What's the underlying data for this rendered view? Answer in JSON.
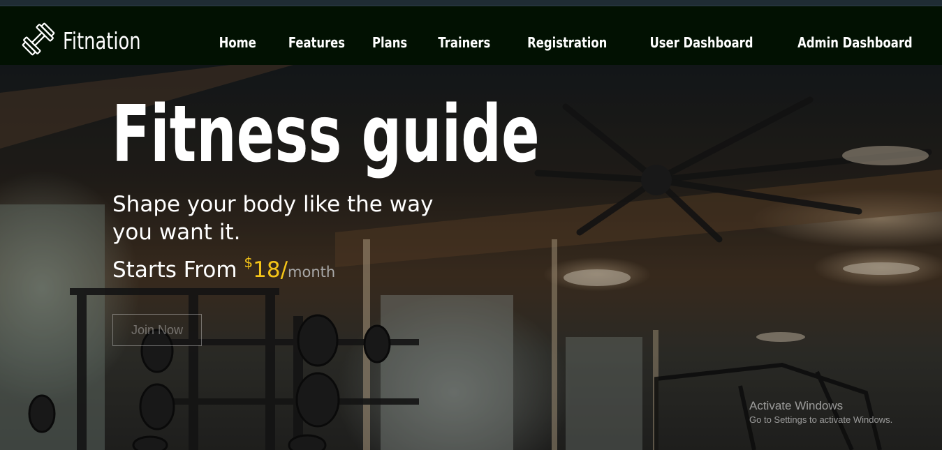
{
  "brand": {
    "name": "Fitnation",
    "icon": "dumbbell-icon"
  },
  "nav": {
    "items": [
      {
        "label": "Home"
      },
      {
        "label": "Features"
      },
      {
        "label": "Plans"
      },
      {
        "label": "Trainers"
      },
      {
        "label": "Registration"
      },
      {
        "label": "User Dashboard"
      },
      {
        "label": "Admin Dashboard"
      }
    ]
  },
  "hero": {
    "title": "Fitness guide",
    "subtitle": "Shape your body like the way you want it.",
    "price_prefix": "Starts From ",
    "price_currency": "$",
    "price_amount": "18/",
    "price_period": "month",
    "cta_label": "Join Now"
  },
  "watermark": {
    "title": "Activate Windows",
    "subtitle": "Go to Settings to activate Windows."
  },
  "colors": {
    "navbar_bg": "#021102",
    "accent": "#f5c518",
    "text": "#ffffff"
  }
}
